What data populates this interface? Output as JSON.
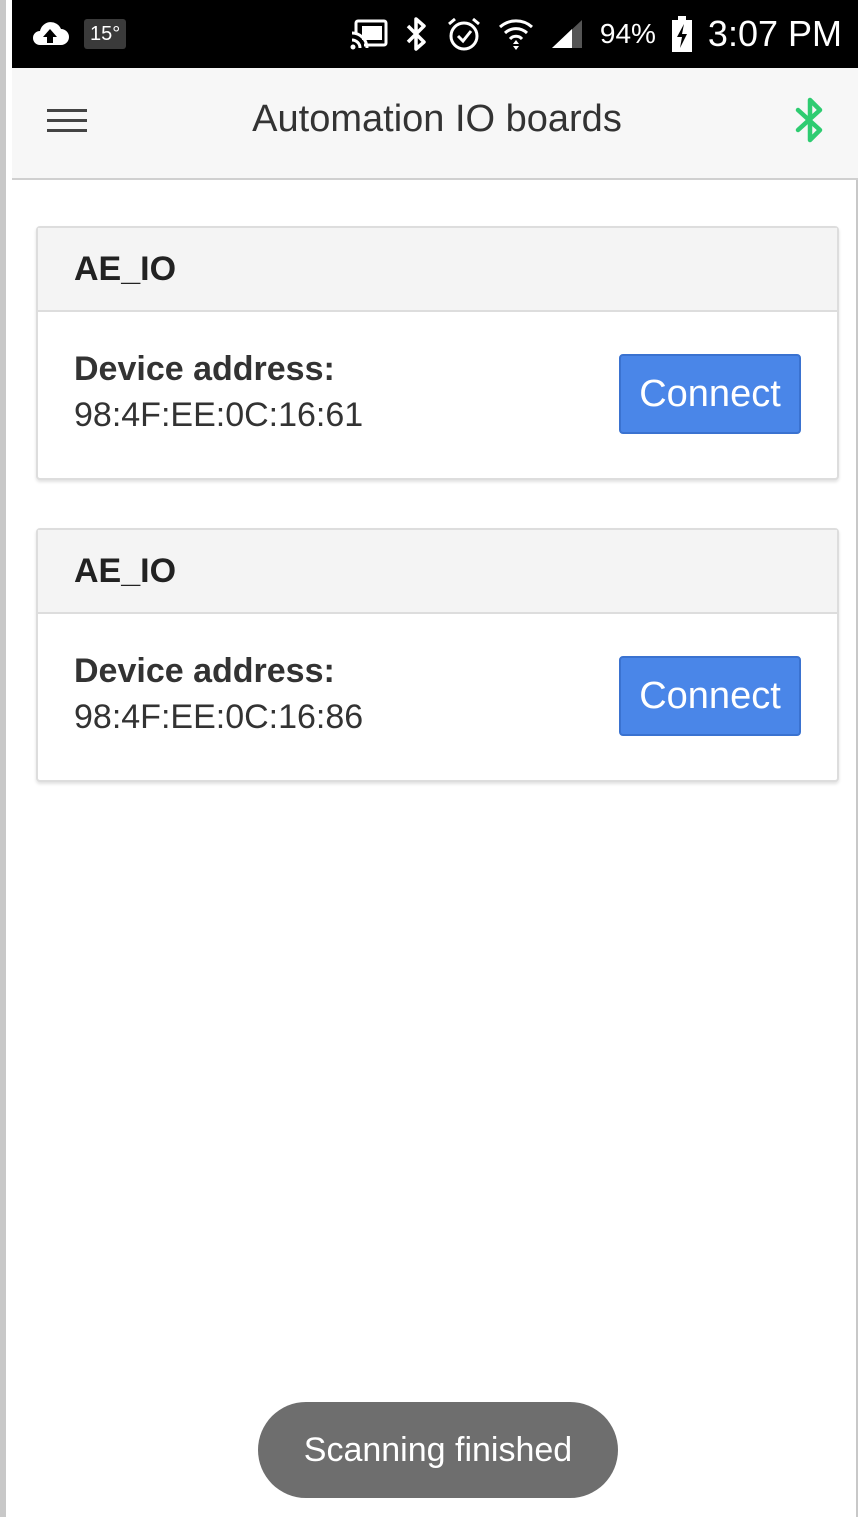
{
  "status_bar": {
    "temperature": "15°",
    "battery_percent": "94%",
    "time": "3:07 PM",
    "icons": [
      "cloud-upload-icon",
      "cast-icon",
      "bluetooth-icon",
      "alarm-icon",
      "wifi-icon",
      "signal-icon",
      "battery-charging-icon"
    ]
  },
  "app_bar": {
    "title": "Automation IO boards",
    "menu_icon": "menu-icon",
    "bluetooth_icon": "bluetooth-icon",
    "bluetooth_color": "#2ecc71"
  },
  "devices": [
    {
      "name": "AE_IO",
      "address_label": "Device address:",
      "address": "98:4F:EE:0C:16:61",
      "button_label": "Connect"
    },
    {
      "name": "AE_IO",
      "address_label": "Device address:",
      "address": "98:4F:EE:0C:16:86",
      "button_label": "Connect"
    }
  ],
  "toast": {
    "message": "Scanning finished"
  },
  "colors": {
    "accent": "#4a86e8",
    "toast_bg": "#6e6e6e"
  }
}
